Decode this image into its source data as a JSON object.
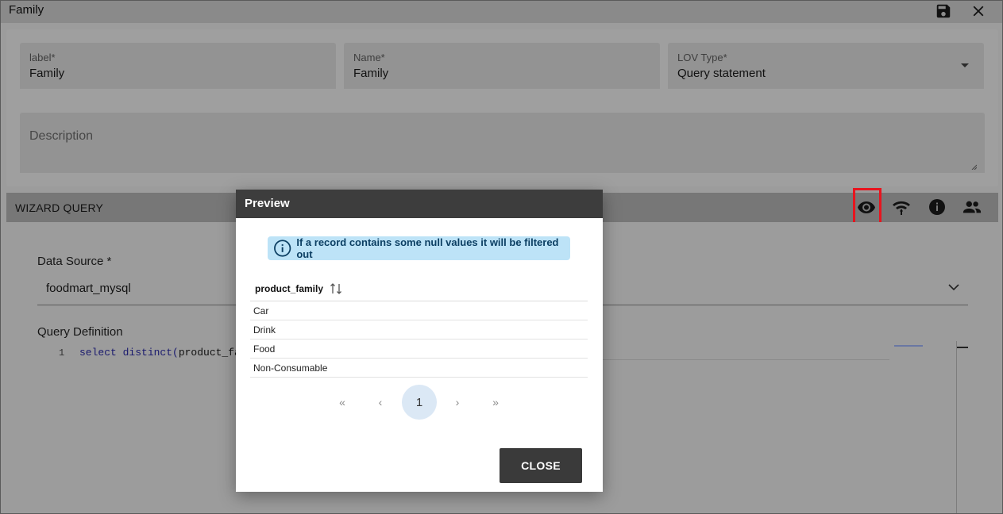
{
  "window": {
    "title": "Family"
  },
  "form": {
    "label_field": {
      "label": "label*",
      "value": "Family"
    },
    "name_field": {
      "label": "Name*",
      "value": "Family"
    },
    "lov_type_field": {
      "label": "LOV Type*",
      "value": "Query statement"
    },
    "description_field": {
      "placeholder": "Description"
    }
  },
  "wizard": {
    "title": "WIZARD QUERY",
    "icons": [
      "preview-eye-icon",
      "wifi-tethering-icon",
      "info-icon",
      "profile-attributes-icon"
    ]
  },
  "data_source": {
    "label": "Data Source *",
    "value": "foodmart_mysql"
  },
  "query": {
    "label": "Query Definition",
    "line_number": "1",
    "code_keyword": "select distinct(",
    "code_rest": "product_fam"
  },
  "preview": {
    "title": "Preview",
    "info": "If a record contains some null values it will be filtered out",
    "column": "product_family",
    "rows": [
      "Car",
      "Drink",
      "Food",
      "Non-Consumable"
    ],
    "pager": {
      "first": "«",
      "prev": "‹",
      "current": "1",
      "next": "›",
      "last": "»"
    },
    "close_label": "CLOSE"
  },
  "colors": {
    "highlight": "#e8141e",
    "info_bg": "#bde3f7",
    "modal_header": "#3d3d3d"
  }
}
